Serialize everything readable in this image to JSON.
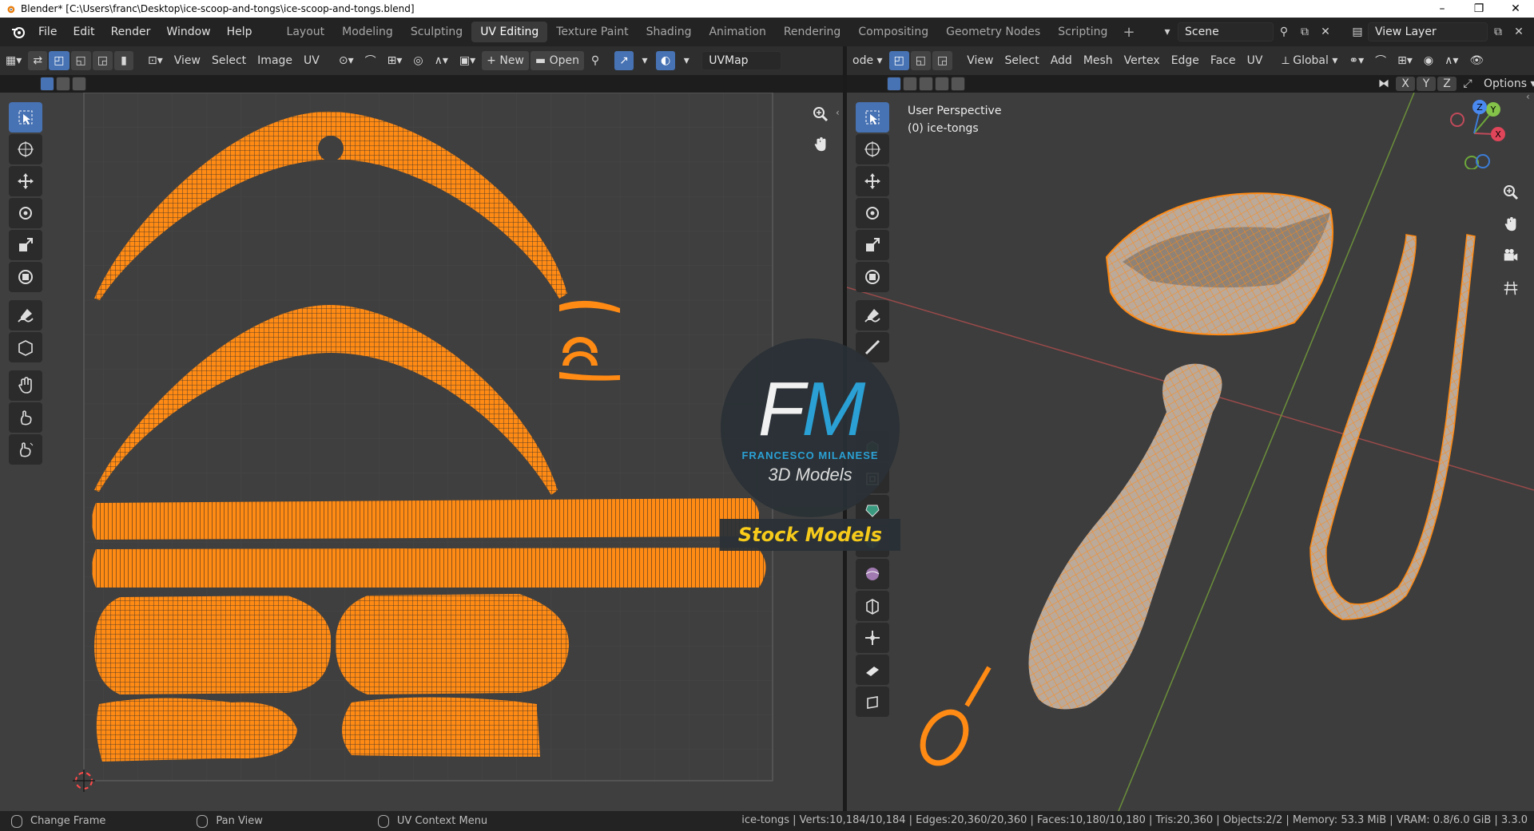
{
  "window": {
    "title": "Blender* [C:\\Users\\franc\\Desktop\\ice-scoop-and-tongs\\ice-scoop-and-tongs.blend]",
    "controls": [
      "–",
      "❐",
      "✕"
    ]
  },
  "menu": [
    "File",
    "Edit",
    "Render",
    "Window",
    "Help"
  ],
  "workspaces": {
    "tabs": [
      "Layout",
      "Modeling",
      "Sculpting",
      "UV Editing",
      "Texture Paint",
      "Shading",
      "Animation",
      "Rendering",
      "Compositing",
      "Geometry Nodes",
      "Scripting"
    ],
    "active": "UV Editing"
  },
  "scene": {
    "name": "Scene",
    "view_layer": "View Layer"
  },
  "uv_editor": {
    "menus": [
      "View",
      "Select",
      "Image",
      "UV"
    ],
    "new_label": "New",
    "open_label": "Open",
    "uvmap": "UVMap"
  },
  "view3d": {
    "mode_label": "ode",
    "menus": [
      "View",
      "Select",
      "Add",
      "Mesh",
      "Vertex",
      "Edge",
      "Face",
      "UV"
    ],
    "orientation": "Global",
    "axes": [
      "X",
      "Y",
      "Z"
    ],
    "options_label": "Options",
    "perspective": "User Perspective",
    "object_label": "(0) ice-tongs",
    "gizmo_axes": [
      "X",
      "Y",
      "Z"
    ]
  },
  "watermark": {
    "initials_f": "F",
    "initials_m": "M",
    "name": "FRANCESCO MILANESE",
    "subtitle": "3D Models",
    "banner": "Stock Models"
  },
  "status": {
    "left": [
      {
        "label": "Change Frame"
      },
      {
        "label": "Pan View"
      },
      {
        "label": "UV Context Menu"
      }
    ],
    "stats": "ice-tongs | Verts:10,184/10,184 | Edges:20,360/20,360 | Faces:10,180/10,180 | Tris:20,360 | Objects:2/2 | Memory: 53.3 MiB | VRAM: 0.8/6.0 GiB | 3.3.0"
  },
  "colors": {
    "accent": "#4772b3",
    "mesh": "#ff8a14",
    "uv_bg": "#3f3f3f",
    "view_bg": "#3d3d3d"
  }
}
